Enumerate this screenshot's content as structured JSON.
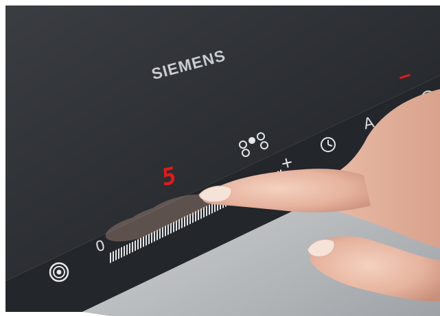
{
  "brand": "SIEMENS",
  "cooktop": {
    "power_level_display": "5",
    "slider_min_label": "0",
    "plus_label": "+",
    "a_label": "A"
  },
  "colors": {
    "glass": "#2a2d31",
    "display_red": "#e11b1b",
    "control_white": "#e6e8ea",
    "background": "#ffffff"
  },
  "icons": [
    "power-ring-icon",
    "cooking-zones-icon",
    "timer-clock-icon",
    "power-icon"
  ]
}
